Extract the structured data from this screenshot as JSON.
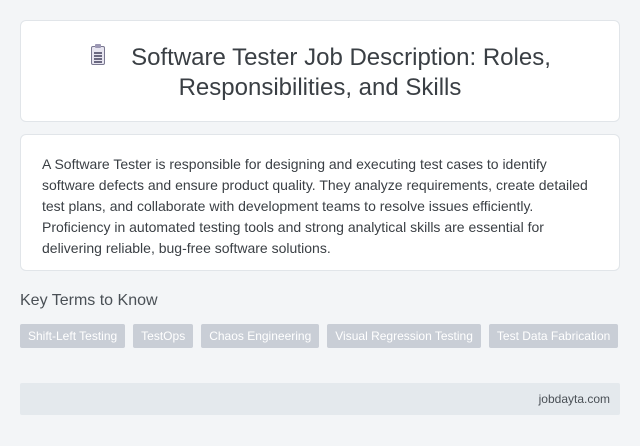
{
  "header": {
    "icon": "document-clipboard-icon",
    "title": "Software Tester Job Description: Roles, Responsibilities, and Skills"
  },
  "description": {
    "text": "A Software Tester is responsible for designing and executing test cases to identify software defects and ensure product quality. They analyze requirements, create detailed test plans, and collaborate with development teams to resolve issues efficiently. Proficiency in automated testing tools and strong analytical skills are essential for delivering reliable, bug-free software solutions."
  },
  "key_terms": {
    "heading": "Key Terms to Know",
    "tags": [
      "Shift-Left Testing",
      "TestOps",
      "Chaos Engineering",
      "Visual Regression Testing",
      "Test Data Fabrication"
    ]
  },
  "footer": {
    "site": "jobdayta.com"
  },
  "colors": {
    "background": "#f3f5f7",
    "card": "#ffffff",
    "tag_background": "#c9ced6",
    "footer_background": "#e4e9ed"
  }
}
